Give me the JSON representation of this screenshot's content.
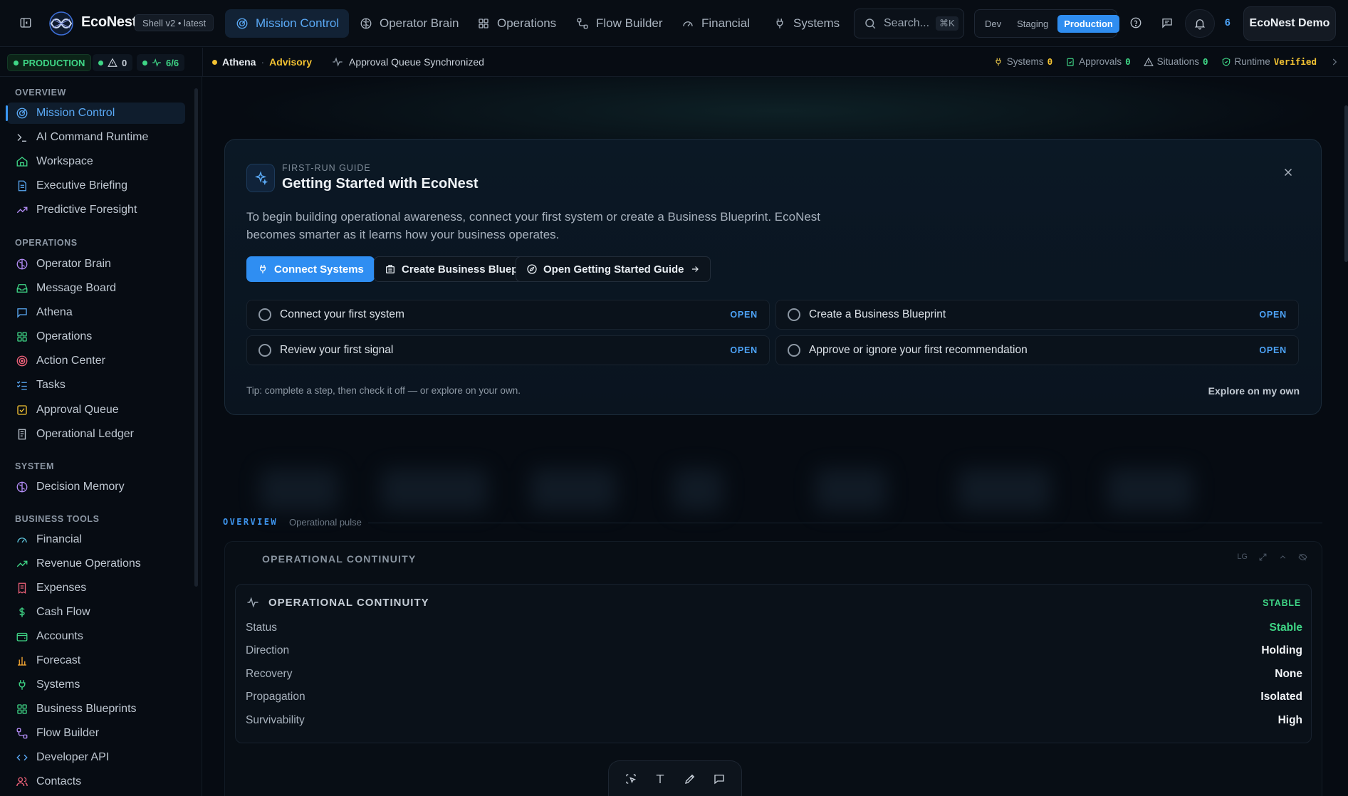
{
  "app": {
    "brand": "EcoNest",
    "version": "Shell v2 • latest"
  },
  "nav": {
    "tabs": [
      {
        "label": "Mission Control",
        "icon": "radar-icon",
        "active": true
      },
      {
        "label": "Operator Brain",
        "icon": "brain-icon"
      },
      {
        "label": "Operations",
        "icon": "grid-icon"
      },
      {
        "label": "Flow Builder",
        "icon": "workflow-icon"
      },
      {
        "label": "Financial",
        "icon": "gauge-icon"
      },
      {
        "label": "Systems",
        "icon": "plug-icon"
      }
    ]
  },
  "search": {
    "placeholder": "Search...",
    "shortcut": "⌘K"
  },
  "environment": {
    "options": [
      "Dev",
      "Staging",
      "Production"
    ],
    "selected": "Production"
  },
  "notifications": {
    "count": "6"
  },
  "user": {
    "name": "EcoNest Demo"
  },
  "statusbar": {
    "env_badge": "PRODUCTION",
    "warnings": "0",
    "health": "6/6",
    "athena_name": "Athena",
    "athena_sep": "·",
    "athena_mode": "Advisory",
    "sync_message": "Approval Queue Synchronized",
    "stats": [
      {
        "label": "Systems",
        "value": "0",
        "icon": "plug-icon"
      },
      {
        "label": "Approvals",
        "value": "0",
        "icon": "clipboard-check-icon"
      },
      {
        "label": "Situations",
        "value": "0",
        "icon": "warning-icon"
      },
      {
        "label": "Runtime",
        "value": "Verified",
        "icon": "shield-check-icon"
      }
    ]
  },
  "sidebar": {
    "sections": [
      {
        "title": "OVERVIEW",
        "items": [
          {
            "label": "Mission Control",
            "icon": "radar-icon",
            "active": true
          },
          {
            "label": "AI Command Runtime",
            "icon": "terminal-icon"
          },
          {
            "label": "Workspace",
            "icon": "home-icon"
          },
          {
            "label": "Executive Briefing",
            "icon": "document-icon"
          },
          {
            "label": "Predictive Foresight",
            "icon": "trend-up-icon"
          }
        ]
      },
      {
        "title": "OPERATIONS",
        "items": [
          {
            "label": "Operator Brain",
            "icon": "brain-icon"
          },
          {
            "label": "Message Board",
            "icon": "inbox-icon"
          },
          {
            "label": "Athena",
            "icon": "chat-icon"
          },
          {
            "label": "Operations",
            "icon": "grid-icon"
          },
          {
            "label": "Action Center",
            "icon": "target-icon"
          },
          {
            "label": "Tasks",
            "icon": "checklist-icon"
          },
          {
            "label": "Approval Queue",
            "icon": "approval-icon"
          },
          {
            "label": "Operational Ledger",
            "icon": "ledger-icon"
          }
        ]
      },
      {
        "title": "SYSTEM",
        "items": [
          {
            "label": "Decision Memory",
            "icon": "brain-icon"
          }
        ]
      },
      {
        "title": "BUSINESS TOOLS",
        "items": [
          {
            "label": "Financial",
            "icon": "gauge-icon"
          },
          {
            "label": "Revenue Operations",
            "icon": "trend-up-icon"
          },
          {
            "label": "Expenses",
            "icon": "receipt-icon"
          },
          {
            "label": "Cash Flow",
            "icon": "dollar-icon"
          },
          {
            "label": "Accounts",
            "icon": "wallet-icon"
          },
          {
            "label": "Forecast",
            "icon": "bar-chart-icon"
          },
          {
            "label": "Systems",
            "icon": "plug-icon"
          },
          {
            "label": "Business Blueprints",
            "icon": "grid-icon"
          },
          {
            "label": "Flow Builder",
            "icon": "workflow-icon"
          },
          {
            "label": "Developer API",
            "icon": "code-icon"
          },
          {
            "label": "Contacts",
            "icon": "users-icon"
          }
        ]
      }
    ]
  },
  "guide": {
    "kicker": "FIRST-RUN GUIDE",
    "title": "Getting Started with EcoNest",
    "description": "To begin building operational awareness, connect your first system or create a Business Blueprint. EcoNest becomes smarter as it learns how your business operates.",
    "buttons": {
      "connect": "Connect Systems",
      "blueprint": "Create Business Blueprint",
      "open_guide": "Open Getting Started Guide"
    },
    "steps": [
      {
        "label": "Connect your first system",
        "action": "OPEN"
      },
      {
        "label": "Create a Business Blueprint",
        "action": "OPEN"
      },
      {
        "label": "Review your first signal",
        "action": "OPEN"
      },
      {
        "label": "Approve or ignore your first recommendation",
        "action": "OPEN"
      }
    ],
    "tip": "Tip: complete a step, then check it off — or explore on your own.",
    "explore": "Explore on my own"
  },
  "overview": {
    "label": "OVERVIEW",
    "sub": "Operational pulse"
  },
  "continuity": {
    "outer_title": "OPERATIONAL CONTINUITY",
    "size_tag": "LG",
    "title": "OPERATIONAL CONTINUITY",
    "state": "STABLE",
    "rows": [
      {
        "key": "Status",
        "value": "Stable"
      },
      {
        "key": "Direction",
        "value": "Holding"
      },
      {
        "key": "Recovery",
        "value": "None"
      },
      {
        "key": "Propagation",
        "value": "Isolated"
      },
      {
        "key": "Survivability",
        "value": "High"
      }
    ]
  },
  "colors": {
    "accent": "#2f8ef2",
    "success": "#3fd686",
    "warning": "#f2c232",
    "background": "#060b12"
  }
}
